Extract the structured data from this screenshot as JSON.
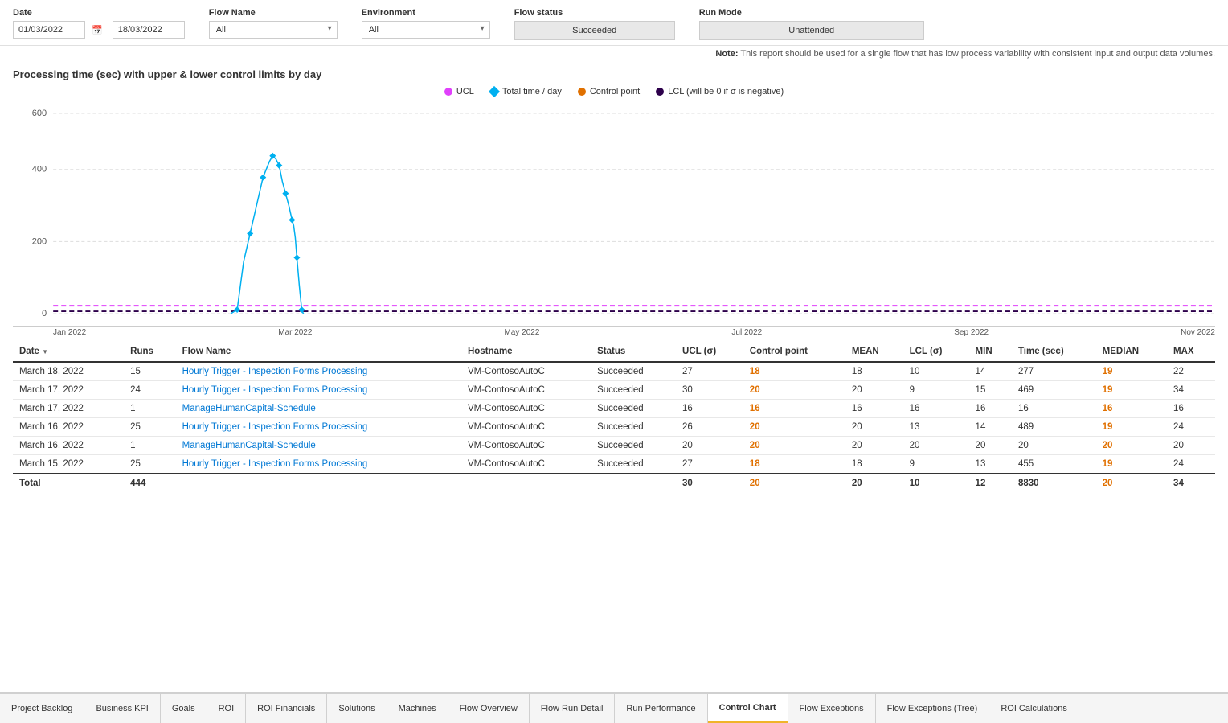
{
  "filters": {
    "date_label": "Date",
    "date_from": "01/03/2022",
    "date_to": "18/03/2022",
    "flow_name_label": "Flow Name",
    "flow_name_value": "All",
    "environment_label": "Environment",
    "environment_value": "All",
    "flow_status_label": "Flow status",
    "flow_status_value": "Succeeded",
    "run_mode_label": "Run Mode",
    "run_mode_value": "Unattended"
  },
  "note": {
    "prefix": "Note:",
    "text": " This report should be used for a single flow that has low process variability with consistent input and output data volumes."
  },
  "chart": {
    "title": "Processing time (sec) with upper & lower control limits by day",
    "legend": [
      {
        "label": "UCL",
        "color": "#e040fb",
        "shape": "dot"
      },
      {
        "label": "Total time / day",
        "color": "#00b0f0",
        "shape": "diamond"
      },
      {
        "label": "Control point",
        "color": "#e07000",
        "shape": "dot"
      },
      {
        "label": "LCL (will be 0 if σ is negative)",
        "color": "#2d004b",
        "shape": "dot"
      }
    ],
    "y_labels": [
      "600",
      "400",
      "200",
      "0"
    ],
    "x_labels": [
      "Jan 2022",
      "Mar 2022",
      "May 2022",
      "Jul 2022",
      "Sep 2022",
      "Nov 2022"
    ]
  },
  "table": {
    "columns": [
      {
        "id": "date",
        "label": "Date",
        "sortable": true
      },
      {
        "id": "runs",
        "label": "Runs"
      },
      {
        "id": "flow_name",
        "label": "Flow Name"
      },
      {
        "id": "hostname",
        "label": "Hostname"
      },
      {
        "id": "status",
        "label": "Status"
      },
      {
        "id": "ucl",
        "label": "UCL (σ)"
      },
      {
        "id": "control_point",
        "label": "Control point"
      },
      {
        "id": "mean",
        "label": "MEAN"
      },
      {
        "id": "lcl",
        "label": "LCL (σ)"
      },
      {
        "id": "min",
        "label": "MIN"
      },
      {
        "id": "time_sec",
        "label": "Time (sec)"
      },
      {
        "id": "median",
        "label": "MEDIAN"
      },
      {
        "id": "max",
        "label": "MAX"
      }
    ],
    "rows": [
      {
        "date": "March 18, 2022",
        "runs": "15",
        "flow_name": "Hourly Trigger - Inspection Forms Processing",
        "hostname": "VM-ContosoAutoC",
        "status": "Succeeded",
        "ucl": "27",
        "control_point": "18",
        "mean": "18",
        "lcl": "10",
        "min": "14",
        "time_sec": "277",
        "median": "19",
        "max": "22"
      },
      {
        "date": "March 17, 2022",
        "runs": "24",
        "flow_name": "Hourly Trigger - Inspection Forms Processing",
        "hostname": "VM-ContosoAutoC",
        "status": "Succeeded",
        "ucl": "30",
        "control_point": "20",
        "mean": "20",
        "lcl": "9",
        "min": "15",
        "time_sec": "469",
        "median": "19",
        "max": "34"
      },
      {
        "date": "March 17, 2022",
        "runs": "1",
        "flow_name": "ManageHumanCapital-Schedule",
        "hostname": "VM-ContosoAutoC",
        "status": "Succeeded",
        "ucl": "16",
        "control_point": "16",
        "mean": "16",
        "lcl": "16",
        "min": "16",
        "time_sec": "16",
        "median": "16",
        "max": "16"
      },
      {
        "date": "March 16, 2022",
        "runs": "25",
        "flow_name": "Hourly Trigger - Inspection Forms Processing",
        "hostname": "VM-ContosoAutoC",
        "status": "Succeeded",
        "ucl": "26",
        "control_point": "20",
        "mean": "20",
        "lcl": "13",
        "min": "14",
        "time_sec": "489",
        "median": "19",
        "max": "24"
      },
      {
        "date": "March 16, 2022",
        "runs": "1",
        "flow_name": "ManageHumanCapital-Schedule",
        "hostname": "VM-ContosoAutoC",
        "status": "Succeeded",
        "ucl": "20",
        "control_point": "20",
        "mean": "20",
        "lcl": "20",
        "min": "20",
        "time_sec": "20",
        "median": "20",
        "max": "20"
      },
      {
        "date": "March 15, 2022",
        "runs": "25",
        "flow_name": "Hourly Trigger - Inspection Forms Processing",
        "hostname": "VM-ContosoAutoC",
        "status": "Succeeded",
        "ucl": "27",
        "control_point": "18",
        "mean": "18",
        "lcl": "9",
        "min": "13",
        "time_sec": "455",
        "median": "19",
        "max": "24"
      }
    ],
    "total_row": {
      "label": "Total",
      "runs": "444",
      "ucl": "30",
      "control_point": "20",
      "mean": "20",
      "lcl": "10",
      "min": "12",
      "time_sec": "8830",
      "median": "20",
      "max": "34"
    }
  },
  "tabs": [
    {
      "id": "project-backlog",
      "label": "Project Backlog",
      "active": false
    },
    {
      "id": "business-kpi",
      "label": "Business KPI",
      "active": false
    },
    {
      "id": "goals",
      "label": "Goals",
      "active": false
    },
    {
      "id": "roi",
      "label": "ROI",
      "active": false
    },
    {
      "id": "roi-financials",
      "label": "ROI Financials",
      "active": false
    },
    {
      "id": "solutions",
      "label": "Solutions",
      "active": false
    },
    {
      "id": "machines",
      "label": "Machines",
      "active": false
    },
    {
      "id": "flow-overview",
      "label": "Flow Overview",
      "active": false
    },
    {
      "id": "flow-run-detail",
      "label": "Flow Run Detail",
      "active": false
    },
    {
      "id": "run-performance",
      "label": "Run Performance",
      "active": false
    },
    {
      "id": "control-chart",
      "label": "Control Chart",
      "active": true
    },
    {
      "id": "flow-exceptions",
      "label": "Flow Exceptions",
      "active": false
    },
    {
      "id": "flow-exceptions-tree",
      "label": "Flow Exceptions (Tree)",
      "active": false
    },
    {
      "id": "roi-calculations",
      "label": "ROI Calculations",
      "active": false
    }
  ],
  "colors": {
    "ucl": "#e040fb",
    "total_time": "#00b0f0",
    "control_point": "#e07000",
    "lcl": "#2d004b",
    "accent": "#f0b429",
    "link": "#0078d4"
  }
}
